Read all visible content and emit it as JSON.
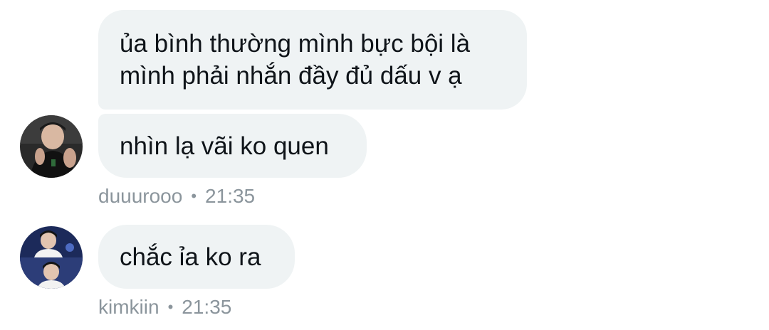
{
  "messages": [
    {
      "text": "ủa bình thường mình bực bội là\nmình phải nhắn đầy đủ dấu v ạ"
    },
    {
      "text": "nhìn lạ vãi ko quen"
    },
    {
      "text": "chắc ỉa ko ra"
    }
  ],
  "meta": [
    {
      "username": "duuurooo",
      "separator": "•",
      "time": "21:35"
    },
    {
      "username": "kimkiin",
      "separator": "•",
      "time": "21:35"
    }
  ],
  "colors": {
    "bubble_bg": "#eff3f4",
    "text": "#0f1419",
    "meta_text": "#8b959c"
  }
}
